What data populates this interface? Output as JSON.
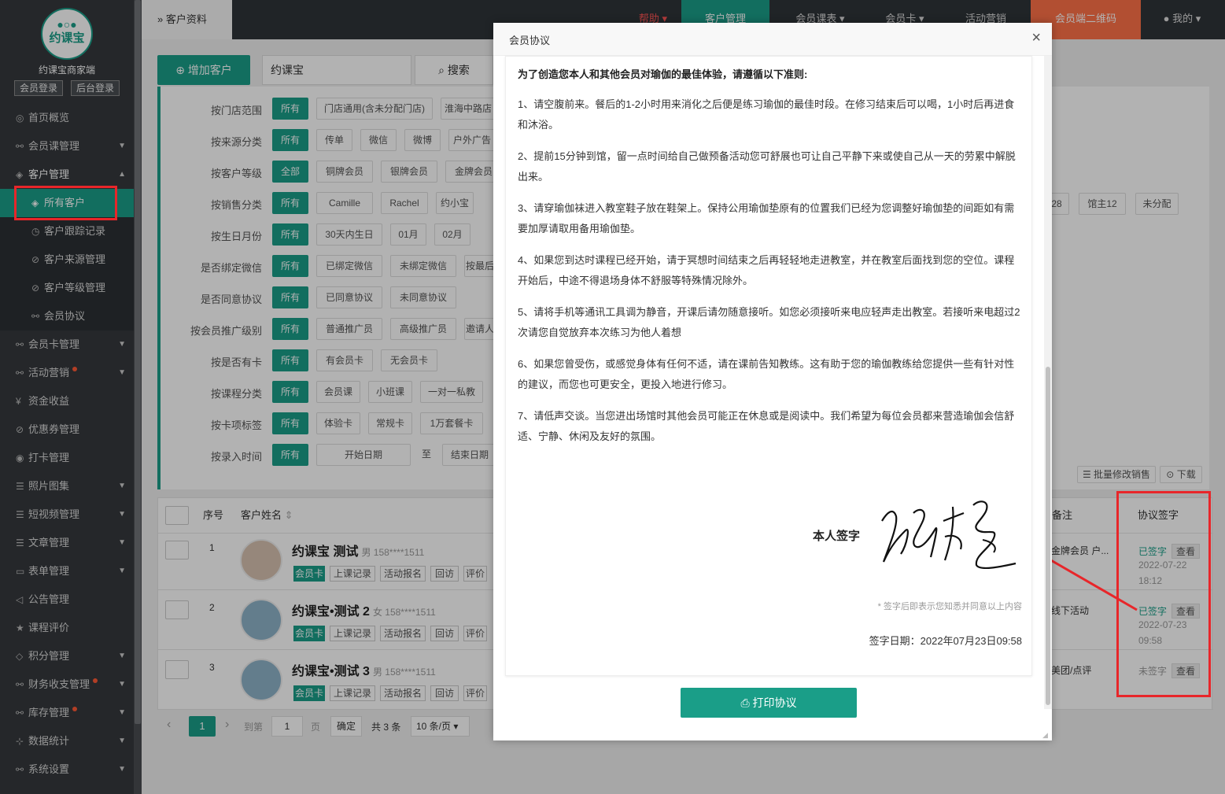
{
  "sidebar": {
    "logo_eyes": "●○●",
    "logo_text": "约课宝",
    "brand": "约课宝商家端",
    "member_login": "会员登录",
    "admin_login": "后台登录",
    "items": [
      {
        "label": "首页概览",
        "icon": "◎"
      },
      {
        "label": "会员课管理",
        "icon": "⚯"
      },
      {
        "label": "客户管理",
        "icon": "◈"
      },
      {
        "label": "所有客户",
        "icon": "◈"
      },
      {
        "label": "客户跟踪记录",
        "icon": "◷"
      },
      {
        "label": "客户来源管理",
        "icon": "⊘"
      },
      {
        "label": "客户等级管理",
        "icon": "⊘"
      },
      {
        "label": "会员协议",
        "icon": "⚯"
      },
      {
        "label": "会员卡管理",
        "icon": "⚯"
      },
      {
        "label": "活动营销",
        "icon": "⚯"
      },
      {
        "label": "资金收益",
        "icon": "¥"
      },
      {
        "label": "优惠券管理",
        "icon": "⊘"
      },
      {
        "label": "打卡管理",
        "icon": "◉"
      },
      {
        "label": "照片图集",
        "icon": "☰"
      },
      {
        "label": "短视频管理",
        "icon": "☰"
      },
      {
        "label": "文章管理",
        "icon": "☰"
      },
      {
        "label": "表单管理",
        "icon": "▭"
      },
      {
        "label": "公告管理",
        "icon": "◁"
      },
      {
        "label": "课程评价",
        "icon": "★"
      },
      {
        "label": "积分管理",
        "icon": "◇"
      },
      {
        "label": "财务收支管理",
        "icon": "⚯"
      },
      {
        "label": "库存管理",
        "icon": "⚯"
      },
      {
        "label": "数据统计",
        "icon": "⊹"
      },
      {
        "label": "系统设置",
        "icon": "⚯"
      }
    ]
  },
  "topbar": {
    "breadcrumb": "客户资料",
    "help": "帮助",
    "customer_mgmt": "客户管理",
    "member_schedule": "会员课表",
    "member_card": "会员卡",
    "activity": "活动营销",
    "qrcode": "会员端二维码",
    "me": "我的"
  },
  "toolbar": {
    "add_customer": "增加客户",
    "search_value": "约课宝",
    "search_btn": "搜索",
    "batch_edit": "批量修改销售",
    "download": "下载"
  },
  "filters": [
    {
      "label": "按门店范围",
      "chips": [
        "所有",
        "门店通用(含未分配门店)",
        "淮海中路店"
      ]
    },
    {
      "label": "按来源分类",
      "chips": [
        "所有",
        "传单",
        "微信",
        "微博",
        "户外广告"
      ]
    },
    {
      "label": "按客户等级",
      "chips": [
        "全部",
        "铜牌会员",
        "银牌会员",
        "金牌会员"
      ]
    },
    {
      "label": "按销售分类",
      "chips": [
        "所有",
        "Camille",
        "Rachel",
        "约小宝"
      ]
    },
    {
      "label": "按生日月份",
      "chips": [
        "所有",
        "30天内生日",
        "01月",
        "02月"
      ]
    },
    {
      "label": "是否绑定微信",
      "chips": [
        "所有",
        "已绑定微信",
        "未绑定微信",
        "按最后"
      ]
    },
    {
      "label": "是否同意协议",
      "chips": [
        "所有",
        "已同意协议",
        "未同意协议"
      ]
    },
    {
      "label": "按会员推广级别",
      "chips": [
        "所有",
        "普通推广员",
        "高级推广员",
        "邀请人"
      ]
    },
    {
      "label": "按是否有卡",
      "chips": [
        "所有",
        "有会员卡",
        "无会员卡"
      ]
    },
    {
      "label": "按课程分类",
      "chips": [
        "所有",
        "会员课",
        "小班课",
        "一对一私教"
      ]
    },
    {
      "label": "按卡项标签",
      "chips": [
        "所有",
        "体验卡",
        "常规卡",
        "1万套餐卡"
      ]
    },
    {
      "label": "按录入时间",
      "chips": [
        "所有",
        "开始日期",
        "至",
        "结束日期"
      ]
    }
  ],
  "sales_extra": [
    "28",
    "馆主12",
    "未分配"
  ],
  "table": {
    "headers": {
      "index": "序号",
      "name": "客户姓名",
      "remark": "备注",
      "signature": "协议签字"
    },
    "action_tags": [
      "会员卡",
      "上课记录",
      "活动报名",
      "回访",
      "评价"
    ],
    "rows": [
      {
        "index": "1",
        "name": "约课宝 测试",
        "meta": "男 158****1511",
        "remark": "金牌会员 户...",
        "sig_status": "已签字",
        "sig_view": "查看",
        "sig_date": "2022-07-22",
        "sig_time": "18:12"
      },
      {
        "index": "2",
        "name": "约课宝•测试 2",
        "meta": "女 158****1511",
        "remark": "线下活动",
        "sig_status": "已签字",
        "sig_view": "查看",
        "sig_date": "2022-07-23",
        "sig_time": "09:58"
      },
      {
        "index": "3",
        "name": "约课宝•测试 3",
        "meta": "男 158****1511",
        "remark": "美团/点评",
        "sig_status": "未签字",
        "sig_view": "查看",
        "sig_date": "",
        "sig_time": ""
      }
    ]
  },
  "pagination": {
    "prev": "‹",
    "current": "1",
    "next": "›",
    "goto_label": "到第",
    "goto_value": "1",
    "page_label": "页",
    "confirm": "确定",
    "total": "共 3 条",
    "per_page": "10 条/页"
  },
  "modal": {
    "title": "会员协议",
    "close": "×",
    "heading": "为了创造您本人和其他会员对瑜伽的最佳体验，请遵循以下准则:",
    "paragraphs": [
      "1、请空腹前来。餐后的1-2小时用来消化之后便是练习瑜伽的最佳时段。在修习结束后可以喝，1小时后再进食和沐浴。",
      "2、提前15分钟到馆，留一点时间给自己做预备活动您可舒展也可让自己平静下来或使自己从一天的劳累中解脱出来。",
      "3、请穿瑜伽袜进入教室鞋子放在鞋架上。保持公用瑜伽垫原有的位置我们已经为您调整好瑜伽垫的间距如有需要加厚请取用备用瑜伽垫。",
      "4、如果您到达时课程已经开始，请于冥想时间结束之后再轻轻地走进教室，并在教室后面找到您的空位。课程开始后，中途不得退场身体不舒服等特殊情况除外。",
      "5、请将手机等通讯工具调为静音，开课后请勿随意接听。如您必须接听来电应轻声走出教室。若接听来电超过2次请您自觉放弃本次练习为他人着想",
      "6、如果您曾受伤，或感觉身体有任何不适，请在课前告知教练。这有助于您的瑜伽教练给您提供一些有针对性的建议，而您也可更安全，更投入地进行修习。",
      "7、请低声交谈。当您进出场馆时其他会员可能正在休息或是阅读中。我们希望为每位会员都来营造瑜伽会信舒适、宁静、休闲及友好的氛围。"
    ],
    "sig_label": "本人签字",
    "sig_note": "* 签字后即表示您知悉并同意以上内容",
    "sig_date": "签字日期：2022年07月23日09:58",
    "print": "打印协议"
  }
}
